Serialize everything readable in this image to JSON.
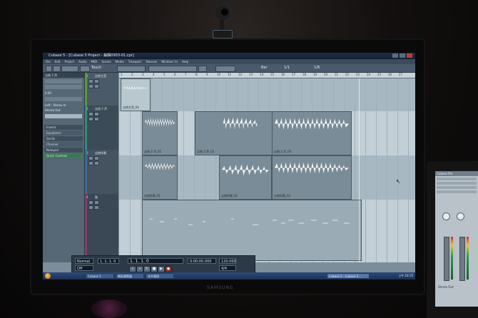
{
  "window": {
    "title": "Cubase 5 - [Cubase 5 Project - 編輯0903-01.cpr]",
    "menu": [
      "File",
      "Edit",
      "Project",
      "Audio",
      "MIDI",
      "Scores",
      "Media",
      "Transport",
      "Devices",
      "Window (1)",
      "Help"
    ],
    "toolbar": {
      "mode": "Touch",
      "grid": "Bar",
      "quantize": "1/1",
      "extra": "1/8"
    }
  },
  "inspector": {
    "title": "吉他 2 声",
    "input": "No Input Selected",
    "value": "0.00",
    "routing_left": "Left - Stereo In",
    "routing_right": "Stereo Out",
    "sections": [
      "Inserts",
      "Equalizers",
      "Sends",
      "Channel",
      "Notepad",
      "Quick Controls"
    ]
  },
  "tracks": [
    {
      "num": "1",
      "name": "吉他主音",
      "color": "#5a9a3a"
    },
    {
      "num": "2",
      "name": "吉他 2 声",
      "color": "#3a8a7a"
    },
    {
      "num": "3",
      "name": "吉他伴奏",
      "color": "#3a6a9a"
    },
    {
      "num": "4",
      "name": "鼓",
      "color": "#8a3a6a"
    }
  ],
  "ruler": {
    "marks": [
      "1",
      "2",
      "3",
      "4",
      "5",
      "6",
      "7",
      "8",
      "9",
      "10",
      "11",
      "12",
      "13",
      "14",
      "15",
      "16",
      "17",
      "18",
      "19",
      "20",
      "21",
      "22",
      "23",
      "24",
      "25",
      "26",
      "27"
    ]
  },
  "clips": [
    {
      "label": "吉他主音_01"
    },
    {
      "label": "吉他 2 声_01"
    },
    {
      "label": "吉他 2 声_02"
    },
    {
      "label": "吉他 2 声_03"
    },
    {
      "label": "吉他伴奏_01"
    },
    {
      "label": "吉他伴奏_02"
    },
    {
      "label": "吉他伴奏_03"
    },
    {
      "label": "吉他伴奏_04"
    }
  ],
  "transport": {
    "left": "Normal",
    "sync": "Off",
    "position": "1. 1. 1. 0",
    "time": "0:00:00.000",
    "tempo": "120.000",
    "signature": "4/4"
  },
  "taskbar": {
    "tasks": [
      "Cubase 5",
      "網頁瀏覽器",
      "文件管理",
      "Cubase 5 - Cubase 5..."
    ],
    "clock": "上午 10:15"
  },
  "laptop": {
    "title": "Cubase Pro",
    "channel": "Stereo Out"
  },
  "monitor_brand": "SAMSUNG"
}
